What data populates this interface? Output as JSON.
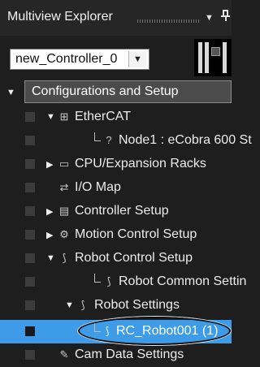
{
  "panel": {
    "title": "Multiview Explorer",
    "menu_icon": "chevron-down-icon",
    "pin_icon": "pin-icon"
  },
  "controller_select": {
    "value": "new_Controller_0",
    "arrow": "▼"
  },
  "tree": {
    "root": {
      "label": "Configurations and Setup",
      "expanded": true
    },
    "items": [
      {
        "label": "EtherCAT",
        "toggle": "▼",
        "icon": "ethercat-icon",
        "icon_glyph": "⊞"
      },
      {
        "label": "Node1 : eCobra 600 St",
        "toggle": "",
        "icon": "node-icon",
        "icon_glyph": "?"
      },
      {
        "label": "CPU/Expansion Racks",
        "toggle": "▶",
        "icon": "rack-icon",
        "icon_glyph": "▭"
      },
      {
        "label": "I/O Map",
        "toggle": "",
        "icon": "io-map-icon",
        "icon_glyph": "⇄"
      },
      {
        "label": "Controller Setup",
        "toggle": "▶",
        "icon": "controller-setup-icon",
        "icon_glyph": "▤"
      },
      {
        "label": "Motion Control Setup",
        "toggle": "▶",
        "icon": "motion-control-icon",
        "icon_glyph": "⚙"
      },
      {
        "label": "Robot Control Setup",
        "toggle": "▼",
        "icon": "robot-control-icon",
        "icon_glyph": "⟆"
      },
      {
        "label": "Robot Common Settin",
        "toggle": "",
        "icon": "robot-common-icon",
        "icon_glyph": "⟆"
      },
      {
        "label": "Robot Settings",
        "toggle": "▼",
        "icon": "robot-settings-icon",
        "icon_glyph": "⟆"
      },
      {
        "label": "RC_Robot001 (1)",
        "toggle": "",
        "icon": "robot-icon",
        "icon_glyph": "⟆",
        "selected": true
      },
      {
        "label": "Cam Data Settings",
        "toggle": "",
        "icon": "cam-data-icon",
        "icon_glyph": "✎"
      }
    ]
  },
  "colors": {
    "background": "#1e1e1e",
    "selection": "#3d9be8",
    "header_bar": "#4b4b4b"
  }
}
